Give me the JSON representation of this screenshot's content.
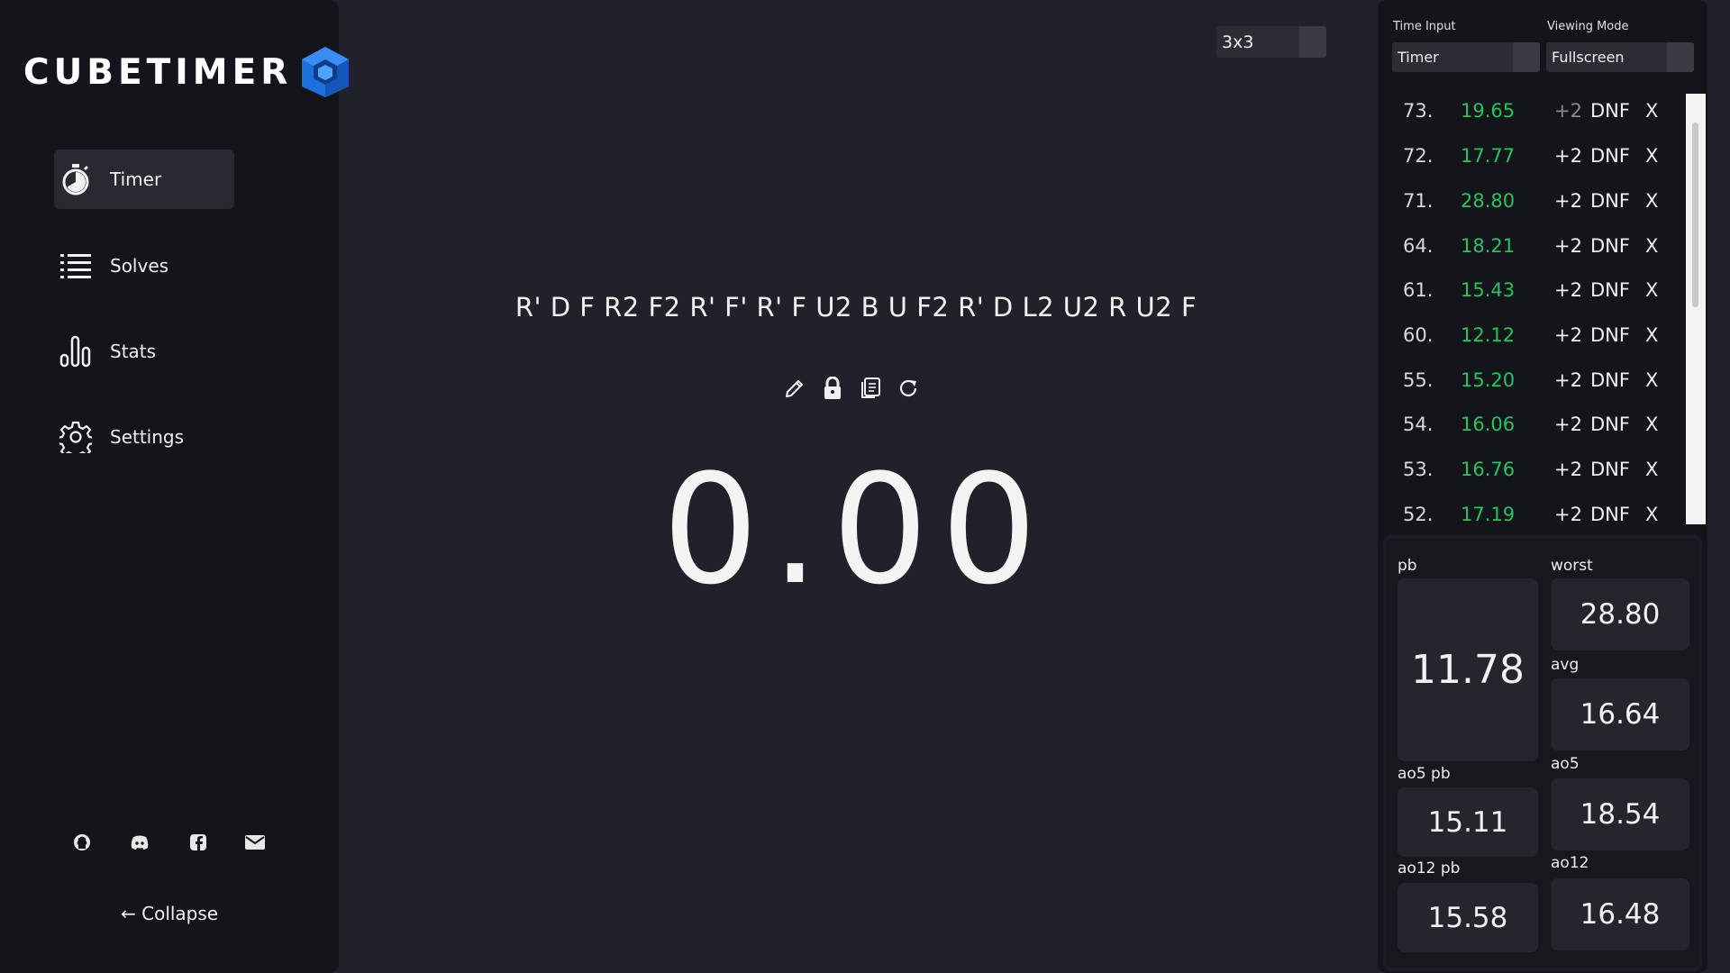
{
  "brand": {
    "name": "CUBETIMER"
  },
  "sidebar": {
    "items": [
      {
        "label": "Timer",
        "icon": "stopwatch-icon",
        "active": true
      },
      {
        "label": "Solves",
        "icon": "list-icon",
        "active": false
      },
      {
        "label": "Stats",
        "icon": "bar-chart-icon",
        "active": false
      },
      {
        "label": "Settings",
        "icon": "gear-icon",
        "active": false
      }
    ],
    "social": [
      "github-icon",
      "discord-icon",
      "facebook-icon",
      "email-icon"
    ],
    "collapse_label": "← Collapse"
  },
  "puzzle": {
    "selected": "3x3"
  },
  "scramble": "R' D F R2 F2 R' F' R' F U2 B U F2 R' D L2 U2 R U2 F",
  "tools": [
    "edit-icon",
    "lock-icon",
    "copy-icon",
    "refresh-icon"
  ],
  "timer": {
    "display": "0.00"
  },
  "controls": {
    "time_input": {
      "label": "Time Input",
      "value": "Timer"
    },
    "viewing_mode": {
      "label": "Viewing Mode",
      "value": "Fullscreen"
    }
  },
  "solves": [
    {
      "num": "73.",
      "time": "19.65",
      "plus2": "+2",
      "dnf": "DNF",
      "del": "X",
      "plus2_dim": true
    },
    {
      "num": "72.",
      "time": "17.77",
      "plus2": "+2",
      "dnf": "DNF",
      "del": "X"
    },
    {
      "num": "71.",
      "time": "28.80",
      "plus2": "+2",
      "dnf": "DNF",
      "del": "X"
    },
    {
      "num": "64.",
      "time": "18.21",
      "plus2": "+2",
      "dnf": "DNF",
      "del": "X"
    },
    {
      "num": "61.",
      "time": "15.43",
      "plus2": "+2",
      "dnf": "DNF",
      "del": "X"
    },
    {
      "num": "60.",
      "time": "12.12",
      "plus2": "+2",
      "dnf": "DNF",
      "del": "X"
    },
    {
      "num": "55.",
      "time": "15.20",
      "plus2": "+2",
      "dnf": "DNF",
      "del": "X"
    },
    {
      "num": "54.",
      "time": "16.06",
      "plus2": "+2",
      "dnf": "DNF",
      "del": "X"
    },
    {
      "num": "53.",
      "time": "16.76",
      "plus2": "+2",
      "dnf": "DNF",
      "del": "X"
    },
    {
      "num": "52.",
      "time": "17.19",
      "plus2": "+2",
      "dnf": "DNF",
      "del": "X"
    }
  ],
  "stats": {
    "pb": {
      "label": "pb",
      "value": "11.78"
    },
    "worst": {
      "label": "worst",
      "value": "28.80"
    },
    "avg": {
      "label": "avg",
      "value": "16.64"
    },
    "ao5": {
      "label": "ao5",
      "value": "18.54"
    },
    "ao5_pb": {
      "label": "ao5 pb",
      "value": "15.11"
    },
    "ao12": {
      "label": "ao12",
      "value": "16.48"
    },
    "ao12_pb": {
      "label": "ao12 pb",
      "value": "15.58"
    }
  },
  "colors": {
    "background": "#20212a",
    "panel": "#14151b",
    "accent_green": "#22c55e",
    "logo_blue": "#2f80ed"
  }
}
